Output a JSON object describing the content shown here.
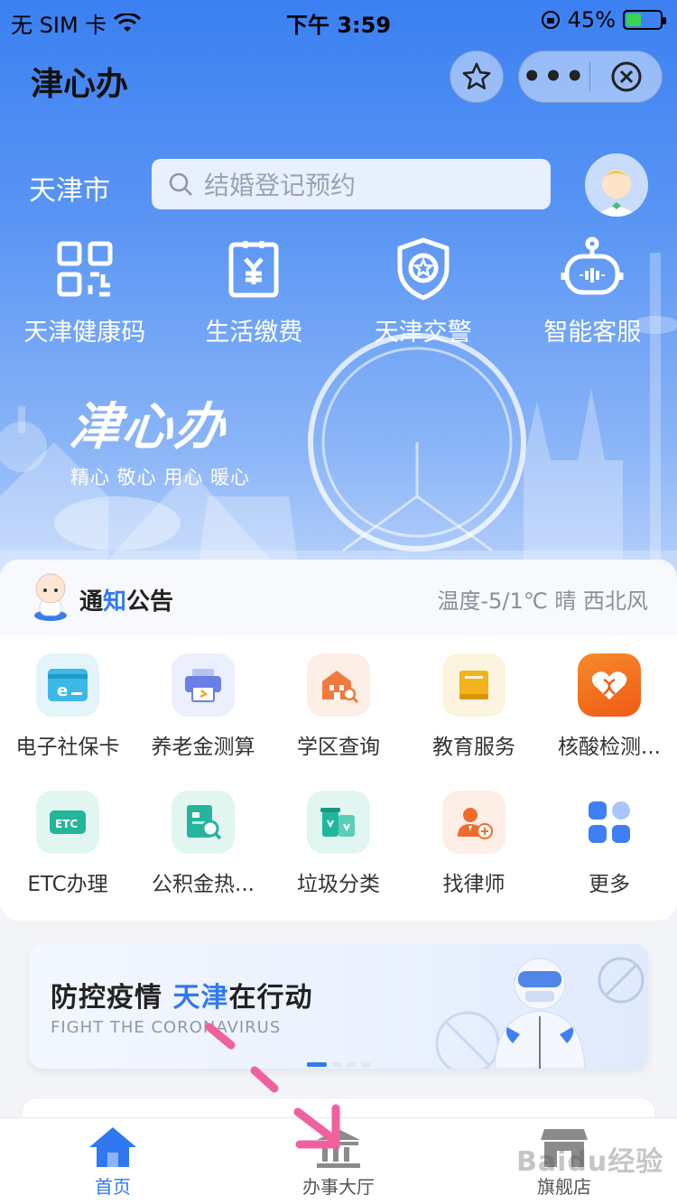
{
  "status_bar": {
    "carrier": "无 SIM 卡",
    "time": "下午 3:59",
    "battery": "45%",
    "battery_level": 0.45
  },
  "header": {
    "title": "津心办"
  },
  "city": "天津市",
  "search": {
    "placeholder": "结婚登记预约"
  },
  "quick_actions": [
    {
      "label": "天津健康码",
      "icon": "qr-code-icon"
    },
    {
      "label": "生活缴费",
      "icon": "bill-icon"
    },
    {
      "label": "天津交警",
      "icon": "police-badge-icon"
    },
    {
      "label": "智能客服",
      "icon": "robot-icon"
    }
  ],
  "brand": {
    "logo": "津心办",
    "slogan": "精心 敬心 用心 暖心"
  },
  "notice": {
    "title_a": "通",
    "title_b": "知",
    "title_c": "公告",
    "weather": "温度-5/1℃ 晴 西北风"
  },
  "services": [
    {
      "label": "电子社保卡",
      "icon": "social-card-icon",
      "color": "#3bb8e8"
    },
    {
      "label": "养老金测算",
      "icon": "printer-icon",
      "color": "#6a7fe6"
    },
    {
      "label": "学区查询",
      "icon": "school-icon",
      "color": "#f07a3e"
    },
    {
      "label": "教育服务",
      "icon": "book-icon",
      "color": "#f3b31c"
    },
    {
      "label": "核酸检测...",
      "icon": "dna-icon",
      "color": "#f0631a"
    },
    {
      "label": "ETC办理",
      "icon": "etc-icon",
      "color": "#23b59a"
    },
    {
      "label": "公积金热...",
      "icon": "document-search-icon",
      "color": "#27b39c"
    },
    {
      "label": "垃圾分类",
      "icon": "trash-bin-icon",
      "color": "#20b89c"
    },
    {
      "label": "找律师",
      "icon": "lawyer-icon",
      "color": "#f06a2a"
    },
    {
      "label": "更多",
      "icon": "grid-more-icon",
      "color": "#3f7ff3"
    }
  ],
  "banner": {
    "head_a": "防控疫情 ",
    "head_b": "天津",
    "head_c": "在行动",
    "sub": "FIGHT THE CORONAVIRUS"
  },
  "tabbar": [
    {
      "label": "首页",
      "icon": "home-icon",
      "active": true
    },
    {
      "label": "办事大厅",
      "icon": "hall-icon",
      "active": false
    },
    {
      "label": "旗舰店",
      "icon": "store-icon",
      "active": false
    }
  ],
  "watermark": "Baidu经验",
  "colors": {
    "primary": "#3279f0",
    "hero_top": "#3b80f2"
  }
}
